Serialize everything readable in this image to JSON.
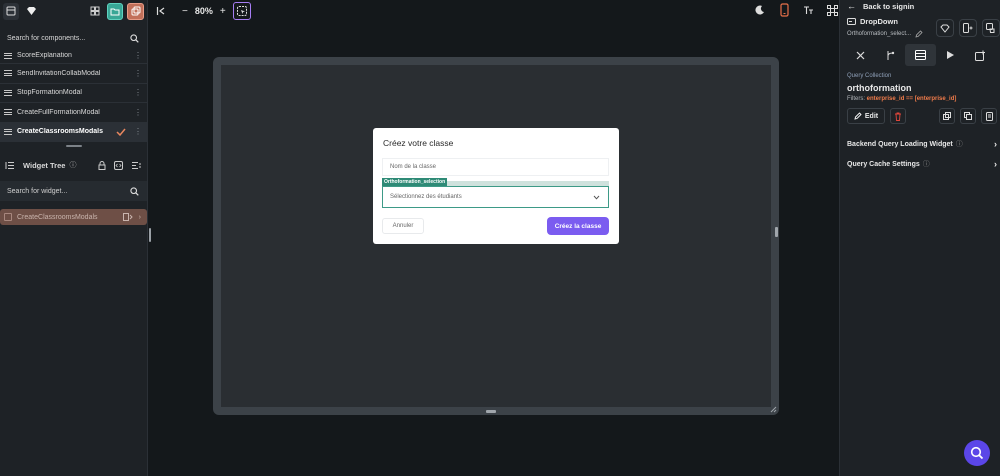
{
  "left_panel": {
    "search_placeholder": "Search for components...",
    "components": [
      {
        "label": "ScoreExplanation",
        "active": false
      },
      {
        "label": "SendInvitationCollabModal",
        "active": false
      },
      {
        "label": "StopFormationModal",
        "active": false
      },
      {
        "label": "CreateFullFormationModal",
        "active": false
      },
      {
        "label": "CreateClassroomsModals",
        "active": true
      }
    ],
    "widget_tree_title": "Widget Tree",
    "widget_search_placeholder": "Search for widget...",
    "tree_root": "CreateClassroomsModals"
  },
  "toolbar": {
    "zoom": "80%",
    "zoom_out": "−",
    "zoom_in": "+"
  },
  "modal": {
    "title": "Créez votre classe",
    "name_placeholder": "Nom de la classe",
    "select_tag": "Orthoformation_selection",
    "select_placeholder": "Sélectionnez des étudiants",
    "cancel_label": "Annuler",
    "create_label": "Créez la classe"
  },
  "right_panel": {
    "back_label": "Back to signin",
    "widget_name": "DropDown",
    "widget_sub": "Orthoformation_select...",
    "query_label": "Query Collection",
    "query_name": "orthoformation",
    "filters_label": "Filters:",
    "filters_value": "enterprise_id == [enterprise_id]",
    "edit_label": "Edit",
    "section1": "Backend Query Loading Widget",
    "section2": "Query Cache Settings"
  },
  "colors": {
    "accent_purple": "#7b5cf0",
    "teal": "#39a796",
    "orange": "#c2705a",
    "filter_orange": "#f07b4a"
  }
}
